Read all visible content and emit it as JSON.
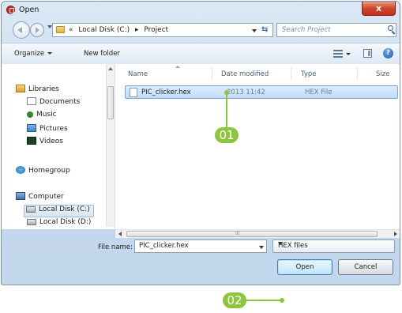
{
  "window": {
    "title": "Open",
    "close_glyph": "x"
  },
  "address": {
    "crumb_prefix": "«",
    "crumbs": [
      "Local Disk (C:)",
      "▸",
      "Project"
    ],
    "search_placeholder": "Search Project"
  },
  "toolbar": {
    "organize_label": "Organize",
    "new_folder_label": "New folder"
  },
  "nav": {
    "items": [
      {
        "label": "Libraries",
        "icon": "libraries-icon"
      },
      {
        "label": "Documents",
        "icon": "documents-icon"
      },
      {
        "label": "Music",
        "icon": "music-icon"
      },
      {
        "label": "Pictures",
        "icon": "pictures-icon"
      },
      {
        "label": "Videos",
        "icon": "videos-icon"
      },
      {
        "label": "Homegroup",
        "icon": "homegroup-icon"
      },
      {
        "label": "Computer",
        "icon": "computer-icon"
      },
      {
        "label": "Local Disk (C:)",
        "icon": "local-disk-icon"
      },
      {
        "label": "Local Disk (D:)",
        "icon": "local-disk-icon"
      }
    ]
  },
  "file_list": {
    "columns": [
      "Name",
      "Date modified",
      "Type",
      "Size"
    ],
    "rows": [
      {
        "name": "PIC_clicker.hex",
        "date_modified": "2013 11:42",
        "type": "HEX File",
        "selected": true
      }
    ]
  },
  "bottom": {
    "file_name_label": "File name:",
    "file_name_value": "PIC_clicker.hex",
    "file_type_value": "HEX files",
    "open_label": "Open",
    "cancel_label": "Cancel"
  },
  "hscroll_grip": "III",
  "callouts": [
    {
      "label": "01"
    },
    {
      "label": "02"
    }
  ],
  "colors": {
    "callout_green": "#8cc63f",
    "selection_border": "#7da2ce",
    "close_red": "#d2452d"
  }
}
